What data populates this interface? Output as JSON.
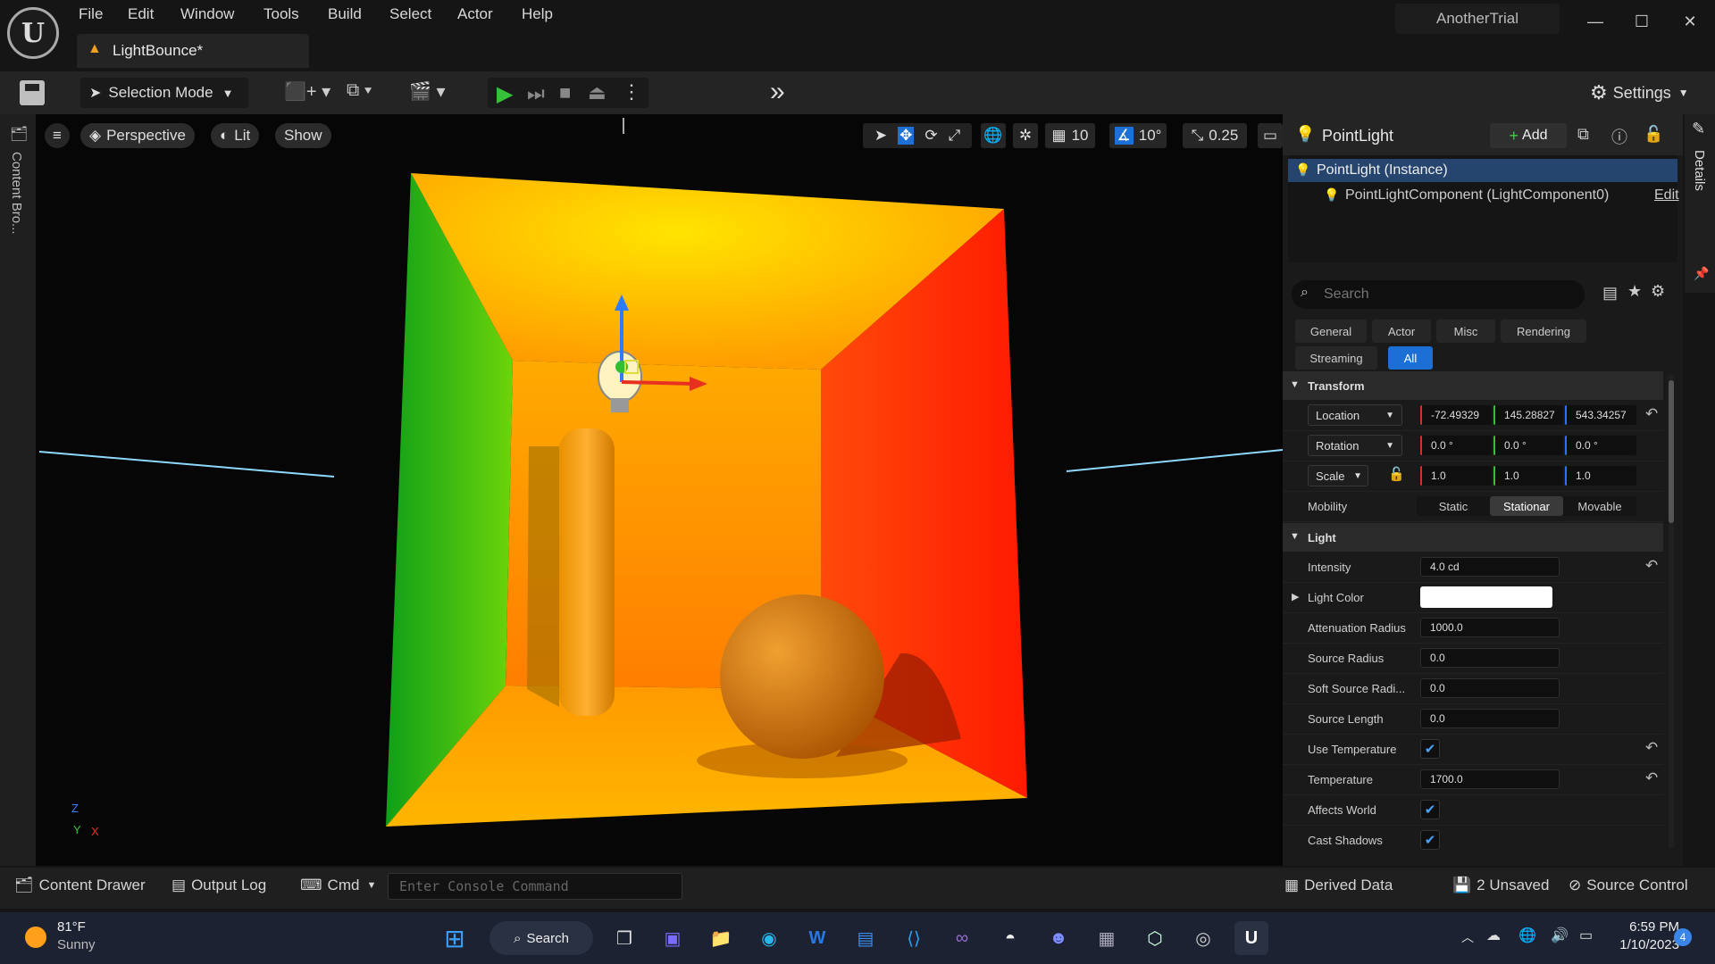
{
  "menu": [
    "File",
    "Edit",
    "Window",
    "Tools",
    "Build",
    "Select",
    "Actor",
    "Help"
  ],
  "tab": {
    "label": "LightBounce*"
  },
  "project": {
    "name": "AnotherTrial"
  },
  "window_controls": {
    "minimize": "—",
    "maximize": "☐",
    "close": "✕"
  },
  "toolbar": {
    "selection_mode": "Selection Mode",
    "overflow": "»",
    "settings": "Settings"
  },
  "left_strip": {
    "content_browser": "Content Bro..."
  },
  "viewport": {
    "menu_icon": "≡",
    "perspective": "Perspective",
    "lit": "Lit",
    "show": "Show",
    "grid_snap": "10",
    "rotation_snap": "10°",
    "scale_snap": "0.25",
    "axis": {
      "z": "Z",
      "y": "Y",
      "x": "X"
    }
  },
  "details": {
    "title": "PointLight",
    "add_label": "Add",
    "tab_label": "Details",
    "components": [
      {
        "label": "PointLight (Instance)"
      },
      {
        "label": "PointLightComponent (LightComponent0)",
        "action": "Edit"
      }
    ],
    "search_placeholder": "Search",
    "filters": [
      "General",
      "Actor",
      "Misc",
      "Rendering",
      "Streaming",
      "All"
    ],
    "active_filter": "All",
    "transform": {
      "title": "Transform",
      "location": {
        "label": "Location",
        "x": "-72.49329",
        "y": "145.28827",
        "z": "543.34257"
      },
      "rotation": {
        "label": "Rotation",
        "x": "0.0 °",
        "y": "0.0 °",
        "z": "0.0 °"
      },
      "scale": {
        "label": "Scale",
        "x": "1.0",
        "y": "1.0",
        "z": "1.0"
      },
      "mobility": {
        "label": "Mobility",
        "options": [
          "Static",
          "Stationar",
          "Movable"
        ],
        "selected": "Stationar"
      }
    },
    "light": {
      "title": "Light",
      "intensity": {
        "label": "Intensity",
        "value": "4.0 cd"
      },
      "light_color": {
        "label": "Light Color",
        "color": "#ffffff"
      },
      "attenuation_radius": {
        "label": "Attenuation Radius",
        "value": "1000.0"
      },
      "source_radius": {
        "label": "Source Radius",
        "value": "0.0"
      },
      "soft_source_radius": {
        "label": "Soft Source Radi...",
        "value": "0.0"
      },
      "source_length": {
        "label": "Source Length",
        "value": "0.0"
      },
      "use_temperature": {
        "label": "Use Temperature",
        "checked": true
      },
      "temperature": {
        "label": "Temperature",
        "value": "1700.0"
      },
      "affects_world": {
        "label": "Affects World",
        "checked": true
      },
      "cast_shadows": {
        "label": "Cast Shadows",
        "checked": true
      }
    }
  },
  "bottom_bar": {
    "content_drawer": "Content Drawer",
    "output_log": "Output Log",
    "cmd": "Cmd",
    "console_placeholder": "Enter Console Command",
    "derived_data": "Derived Data",
    "unsaved": "2 Unsaved",
    "source_control": "Source Control"
  },
  "taskbar": {
    "weather_temp": "81°F",
    "weather_desc": "Sunny",
    "search": "Search",
    "time": "6:59 PM",
    "date": "1/10/2023",
    "notifications": "4"
  }
}
